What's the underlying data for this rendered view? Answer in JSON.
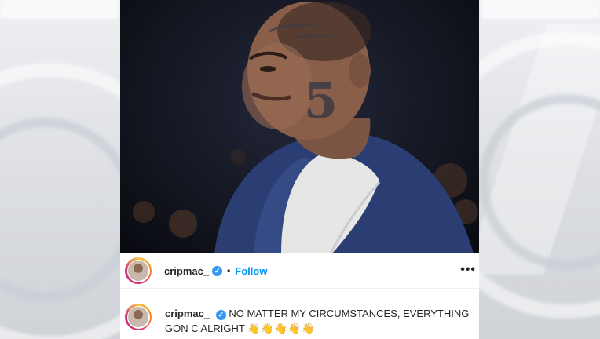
{
  "post": {
    "username": "cripmac_",
    "verified_icon": "verified-badge-icon",
    "separator": "•",
    "follow_label": "Follow",
    "more_icon": "•••",
    "caption": "NO MATTER MY CIRCUMSTANCES, EVERYTHING GON C ALRIGHT",
    "emojis": "👋👋👋👋👋",
    "tattoo_number": "5"
  },
  "colors": {
    "follow_blue": "#0095f6",
    "verified_blue": "#3897f0",
    "text_dark": "#262626"
  }
}
